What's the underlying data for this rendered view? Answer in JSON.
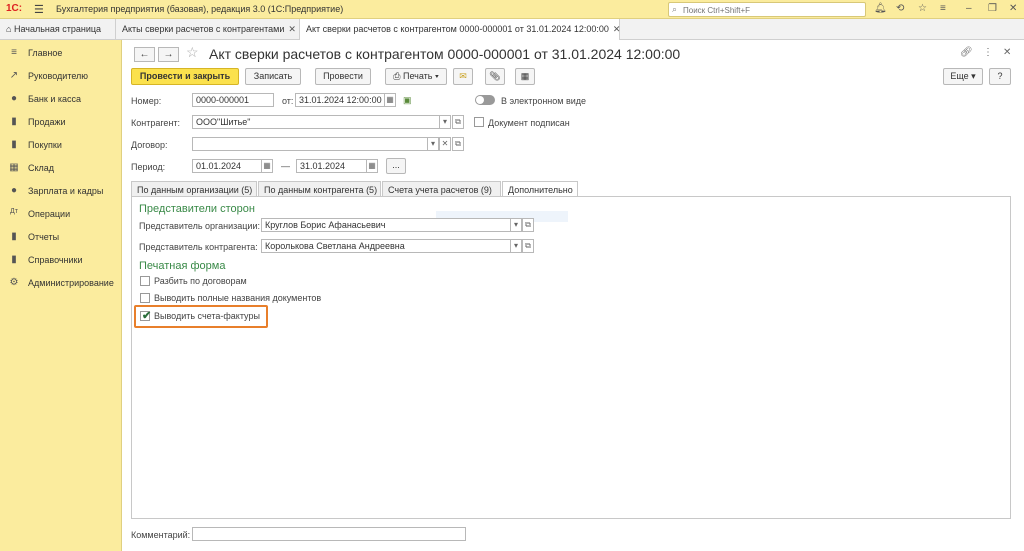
{
  "app": {
    "logo": "1С:",
    "title": "Бухгалтерия предприятия (базовая), редакция 3.0  (1С:Предприятие)",
    "search_placeholder": "Поиск Ctrl+Shift+F"
  },
  "tabs": [
    {
      "label": "Начальная страница"
    },
    {
      "label": "Акты сверки расчетов с контрагентами"
    },
    {
      "label": "Акт сверки расчетов с контрагентом 0000-000001 от 31.01.2024 12:00:00"
    }
  ],
  "sidebar": {
    "items": [
      {
        "label": "Главное",
        "icon": "≡"
      },
      {
        "label": "Руководителю",
        "icon": "↗"
      },
      {
        "label": "Банк и касса",
        "icon": "●"
      },
      {
        "label": "Продажи",
        "icon": "▮"
      },
      {
        "label": "Покупки",
        "icon": "▮"
      },
      {
        "label": "Склад",
        "icon": "▦"
      },
      {
        "label": "Зарплата и кадры",
        "icon": "●"
      },
      {
        "label": "Операции",
        "icon": "Дт"
      },
      {
        "label": "Отчеты",
        "icon": "▮"
      },
      {
        "label": "Справочники",
        "icon": "▮"
      },
      {
        "label": "Администрирование",
        "icon": "⚙"
      }
    ]
  },
  "document": {
    "title": "Акт сверки расчетов с контрагентом 0000-000001 от 31.01.2024 12:00:00"
  },
  "toolbar": {
    "post_close": "Провести и закрыть",
    "save": "Записать",
    "post": "Провести",
    "print": "Печать",
    "more": "Еще",
    "help": "?"
  },
  "form": {
    "number_label": "Номер:",
    "number_value": "0000-000001",
    "date_from_label": "от:",
    "date_value": "31.01.2024 12:00:00",
    "electronic_label": "В электронном виде",
    "contractor_label": "Контрагент:",
    "contractor_value": "ООО\"Шитье\"",
    "signed_label": "Документ подписан",
    "contract_label": "Договор:",
    "contract_value": "",
    "period_label": "Период:",
    "period_from": "01.01.2024",
    "period_dash": "—",
    "period_to": "31.01.2024",
    "period_btn": "...",
    "comment_label": "Комментарий:",
    "comment_value": ""
  },
  "inner_tabs": [
    {
      "label": "По данным организации (5)"
    },
    {
      "label": "По данным контрагента (5)"
    },
    {
      "label": "Счета учета расчетов (9)"
    },
    {
      "label": "Дополнительно"
    }
  ],
  "representatives": {
    "section_title": "Представители сторон",
    "org_label": "Представитель организации:",
    "org_value": "Круглов Борис Афанасьевич",
    "contractor_label": "Представитель контрагента:",
    "contractor_value": "Королькова Светлана Андреевна"
  },
  "print_form": {
    "section_title": "Печатная форма",
    "split_label": "Разбить по договорам",
    "split_checked": false,
    "full_names_label": "Выводить полные названия документов",
    "full_names_checked": false,
    "invoices_label": "Выводить счета-фактуры",
    "invoices_checked": true
  },
  "colors": {
    "accent": "#fbec9e",
    "primary_button": "#fbe14d",
    "section_title": "#3a8a48",
    "highlight": "#e87f2b"
  }
}
